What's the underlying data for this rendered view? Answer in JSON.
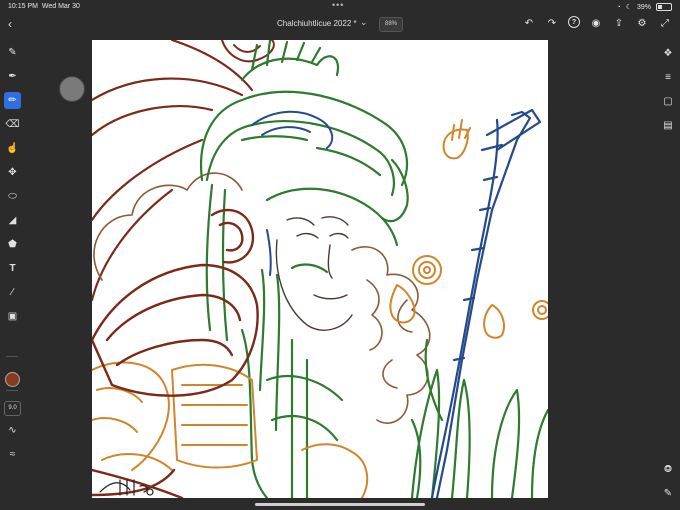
{
  "status_bar": {
    "time": "10:15 PM",
    "date": "Wed Mar 30",
    "dots": "•••",
    "battery_percent": "39%"
  },
  "top_bar": {
    "document_title": "Chalchiuhtlicue 2022 *",
    "zoom_level": "88%"
  },
  "left_toolbar": {
    "tools": [
      "pixel-brush",
      "live-brush",
      "vector-brush",
      "eraser",
      "smudge",
      "move",
      "lasso",
      "fill",
      "shape",
      "type",
      "eyedropper",
      "place-image"
    ],
    "active_tool": "vector-brush",
    "brush_size": "9.0",
    "current_color": "#8b3a1c"
  },
  "right_toolbar": {
    "tools": [
      "layers",
      "layer-properties",
      "select-all",
      "comments",
      "share-timelapse",
      "pen-input"
    ]
  },
  "canvas": {
    "line_colors": {
      "dark_red": "#7b2a18",
      "green": "#2e7a2e",
      "orange": "#d0862c",
      "blue": "#254a8c",
      "brown": "#8b5a38"
    }
  }
}
